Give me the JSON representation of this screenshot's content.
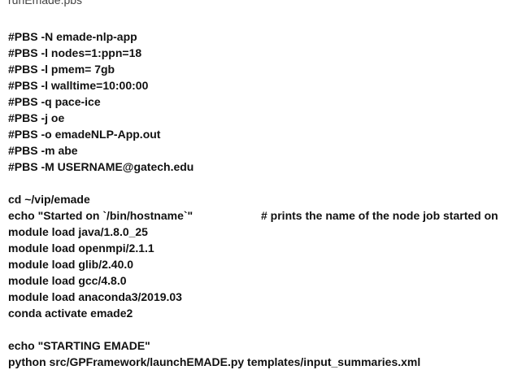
{
  "file": {
    "name": "runEmade.pbs"
  },
  "pbs_directives": [
    "#PBS -N emade-nlp-app",
    "#PBS -l nodes=1:ppn=18",
    "#PBS -l pmem= 7gb",
    "#PBS -l walltime=10:00:00",
    "#PBS -q pace-ice",
    "#PBS -j oe",
    "#PBS -o emadeNLP-App.out",
    "#PBS -m abe",
    "#PBS -M USERNAME@gatech.edu"
  ],
  "setup": {
    "cd": "cd ~/vip/emade",
    "echo_started": "echo \"Started on `/bin/hostname`\"",
    "echo_comment": "# prints the name of the node job started on",
    "modules": [
      "module load java/1.8.0_25",
      "module load openmpi/2.1.1",
      "module load glib/2.40.0",
      "module load gcc/4.8.0",
      "module load anaconda3/2019.03"
    ],
    "conda": "conda activate emade2"
  },
  "run": {
    "echo_starting": "echo \"STARTING EMADE\"",
    "python": "python src/GPFramework/launchEMADE.py templates/input_summaries.xml"
  }
}
